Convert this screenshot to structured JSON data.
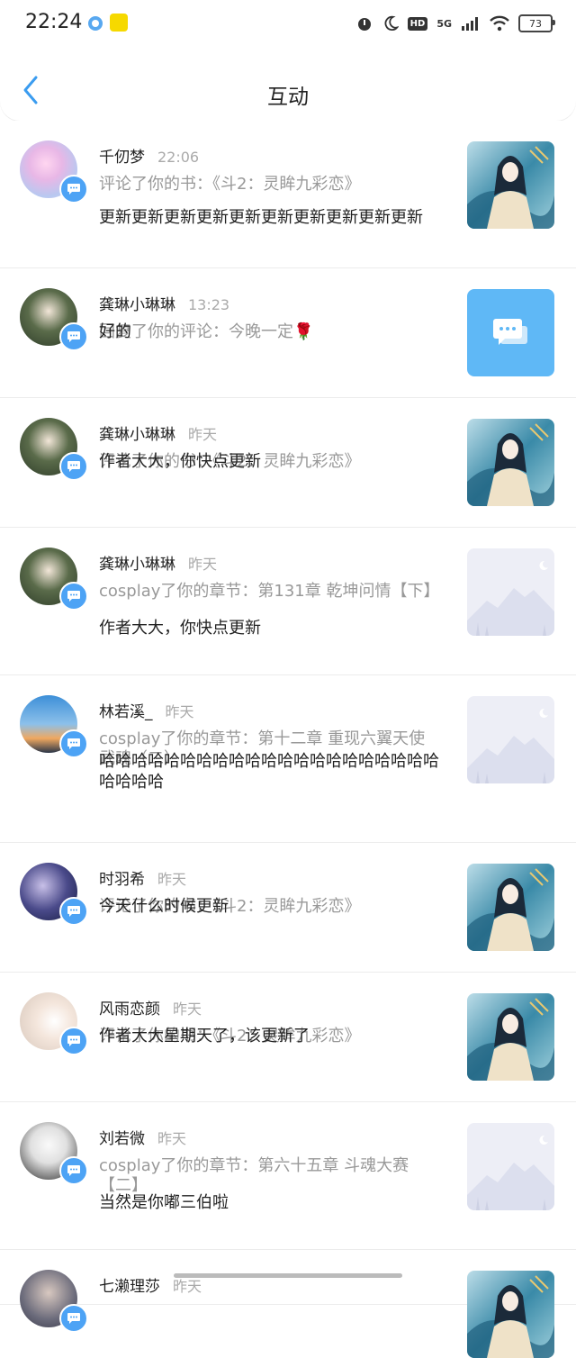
{
  "status": {
    "time": "22:24",
    "network": "5G",
    "hd": "HD",
    "battery": "73"
  },
  "header": {
    "title": "互动"
  },
  "items": [
    {
      "name": "千仞梦",
      "time": "22:06",
      "action": "评论了你的书：《斗2：灵眸九彩恋》",
      "content": "更新更新更新更新更新更新更新更新更新更新",
      "thumb": "book-cover"
    },
    {
      "name": "龚琳小琳琳",
      "time": "13:23",
      "action": "回复了你的评论：今晚一定🌹",
      "content": "好的",
      "thumb": "comment-tile"
    },
    {
      "name": "龚琳小琳琳",
      "time": "昨天",
      "action": "评论了你的书：《斗2：灵眸九彩恋》",
      "content": "作者大大，你快点更新",
      "thumb": "book-cover"
    },
    {
      "name": "龚琳小琳琳",
      "time": "昨天",
      "action": "cosplay了你的章节：第131章 乾坤问情【下】",
      "content": "作者大大，你快点更新",
      "thumb": "placeholder"
    },
    {
      "name": "林若溪_",
      "time": "昨天",
      "action": "cosplay了你的章节：第十二章 重现六翼天使武魂（二）",
      "content": "哈哈哈哈哈哈哈哈哈哈哈哈哈哈哈哈哈哈哈哈哈哈哈哈哈",
      "thumb": "placeholder"
    },
    {
      "name": "时羽希",
      "time": "昨天",
      "action": "评论了你的书：《斗2：灵眸九彩恋》",
      "content": "今天什么时候更新",
      "thumb": "book-cover"
    },
    {
      "name": "风雨恋颜",
      "time": "昨天",
      "action": "评论了你的书：《斗2：灵眸九彩恋》",
      "content": "作者大大星期天了，该更新了",
      "thumb": "book-cover"
    },
    {
      "name": "刘若微",
      "time": "昨天",
      "action": "cosplay了你的章节：第六十五章 斗魂大赛【二】",
      "content": "当然是你嘟三伯啦",
      "thumb": "placeholder"
    },
    {
      "name": "七濑理莎",
      "time": "昨天",
      "action": "",
      "content": "",
      "thumb": "book-cover"
    }
  ]
}
